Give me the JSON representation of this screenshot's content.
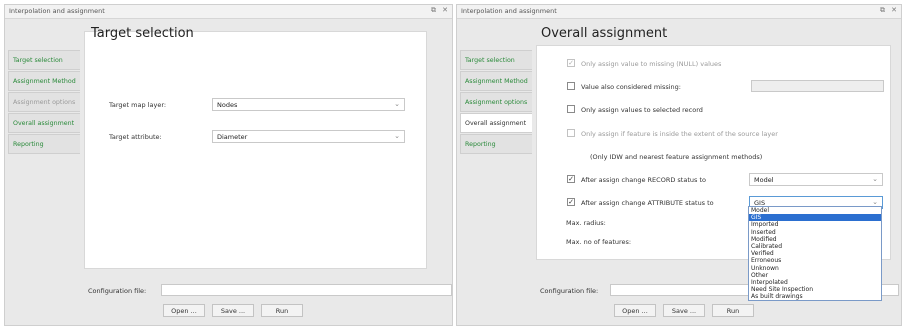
{
  "left": {
    "window_title": "Interpolation and assignment",
    "controls": [
      "⧉",
      "✕"
    ],
    "sidebar": [
      {
        "label": "Target selection",
        "state": "active"
      },
      {
        "label": "Assignment Method",
        "state": "normal"
      },
      {
        "label": "Assignment options",
        "state": "disabled"
      },
      {
        "label": "Overall assignment",
        "state": "normal"
      },
      {
        "label": "Reporting",
        "state": "normal"
      }
    ],
    "panel_title": "Target selection",
    "target_layer_label": "Target map layer:",
    "target_layer_value": "Nodes",
    "target_attr_label": "Target attribute:",
    "target_attr_value": "Diameter",
    "config_label": "Configuration file:",
    "buttons": {
      "open": "Open ...",
      "save": "Save ...",
      "run": "Run"
    }
  },
  "right": {
    "window_title": "Interpolation and assignment",
    "controls": [
      "⧉",
      "✕"
    ],
    "sidebar": [
      {
        "label": "Target selection",
        "state": "normal"
      },
      {
        "label": "Assignment Method",
        "state": "normal"
      },
      {
        "label": "Assignment options",
        "state": "normal"
      },
      {
        "label": "Overall assignment",
        "state": "active"
      },
      {
        "label": "Reporting",
        "state": "normal"
      }
    ],
    "panel_title": "Overall assignment",
    "opt_missing_null": "Only assign value to missing (NULL) values",
    "opt_value_missing": "Value also considered missing:",
    "opt_selected_record": "Only assign values to selected record",
    "opt_inside_extent": "Only assign if feature is inside the extent of the source layer",
    "note": "(Only IDW and nearest feature assignment methods)",
    "opt_record_status": "After assign change RECORD status to",
    "record_status_value": "Model",
    "opt_attr_status": "After assign change ATTRIBUTE status to",
    "attr_status_value": "GIS",
    "max_radius_label": "Max. radius:",
    "max_features_label": "Max. no of features:",
    "config_label": "Configuration file:",
    "buttons": {
      "open": "Open ...",
      "save": "Save ...",
      "run": "Run"
    },
    "status_options": [
      "Model",
      "GIS",
      "Imported",
      "Inserted",
      "Modified",
      "Calibrated",
      "Verified",
      "Erroneous",
      "Unknown",
      "Other",
      "Interpolated",
      "Need Site Inspection",
      "As built drawings"
    ],
    "selected_option": "GIS"
  }
}
